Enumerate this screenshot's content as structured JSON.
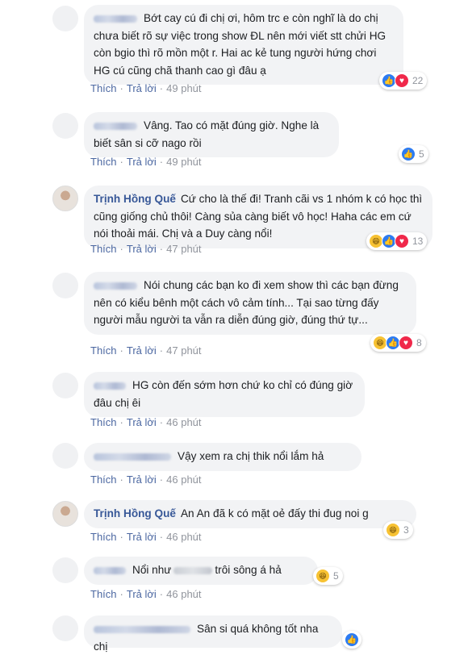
{
  "comments": [
    {
      "author": "",
      "author_blurred": true,
      "avatar": "blank",
      "text": "Bớt cay cú đi chị ơi, hôm trc e còn nghĩ là do chị chưa biết rõ sự việc trong show ĐL nên mới viết stt chửi HG còn bgio thì rõ mồn một r. Hai ac kẻ tung người hứng chơi HG cú cũng chã thanh cao gì đâu ạ",
      "like_label": "Thích",
      "reply_label": "Trả lời",
      "time": "49 phút",
      "reactions": [
        "like",
        "love"
      ],
      "reaction_count": "22"
    },
    {
      "author": "",
      "author_blurred": true,
      "avatar": "blank",
      "text": "Vâng. Tao có mặt đúng giờ. Nghe là biết sân si cỡ nago rồi",
      "like_label": "Thích",
      "reply_label": "Trả lời",
      "time": "49 phút",
      "reactions": [
        "like"
      ],
      "reaction_count": "5"
    },
    {
      "author": "Trịnh Hồng Quế",
      "author_blurred": false,
      "avatar": "photo",
      "text": "Cứ cho là thế đi! Tranh cãi vs 1 nhóm k có học thì cũng giống chủ thôi! Càng sủa càng biết vô học! Haha các em cứ nói thoải mái. Chị và a Duy càng nổi!",
      "like_label": "Thích",
      "reply_label": "Trả lời",
      "time": "47 phút",
      "reactions": [
        "haha",
        "like",
        "love"
      ],
      "reaction_count": "13"
    },
    {
      "author": "",
      "author_blurred": true,
      "avatar": "blank",
      "text": "Nói chung các bạn ko đi xem show thì các bạn đừng nên có kiểu bênh một cách vô cảm tính... Tại sao từng đấy người mẫu người ta vẫn ra diễn đúng giờ, đúng thứ tự...",
      "like_label": "Thích",
      "reply_label": "Trả lời",
      "time": "47 phút",
      "reactions": [
        "haha",
        "like",
        "love"
      ],
      "reaction_count": "8"
    },
    {
      "author": "",
      "author_blurred": true,
      "avatar": "blank",
      "text": "HG còn đến sớm hơn chứ ko chỉ có đúng giờ đâu chị êi",
      "like_label": "Thích",
      "reply_label": "Trả lời",
      "time": "46 phút",
      "reactions": [],
      "reaction_count": ""
    },
    {
      "author": "",
      "author_blurred": true,
      "avatar": "blank",
      "text": "Vậy xem ra chị thik nổi lắm hả",
      "like_label": "Thích",
      "reply_label": "Trả lời",
      "time": "46 phút",
      "reactions": [],
      "reaction_count": ""
    },
    {
      "author": "Trịnh Hồng Quế",
      "author_blurred": false,
      "avatar": "photo",
      "text": "An An đã k có mặt oẻ đấy thi đug noi g",
      "like_label": "Thích",
      "reply_label": "Trả lời",
      "time": "46 phút",
      "reactions": [
        "haha"
      ],
      "reaction_count": "3"
    },
    {
      "author": "",
      "author_blurred": true,
      "avatar": "blank",
      "text_before": "Nổi như",
      "text_after": "trôi sông á hả",
      "like_label": "Thích",
      "reply_label": "Trả lời",
      "time": "46 phút",
      "reactions": [
        "haha"
      ],
      "reaction_count": "5"
    },
    {
      "author": "",
      "author_blurred": true,
      "avatar": "blank",
      "text": "Sân si quá không tốt nha chị",
      "like_label": "",
      "reply_label": "",
      "time": "",
      "reactions": [
        "like"
      ],
      "reaction_count": ""
    }
  ],
  "reaction_glyphs": {
    "like": "👍",
    "love": "♥",
    "haha": "😆"
  },
  "colors": {
    "author": "#385898",
    "bubble": "#f2f3f5",
    "link": "#4b67a1",
    "meta": "#90949c"
  }
}
